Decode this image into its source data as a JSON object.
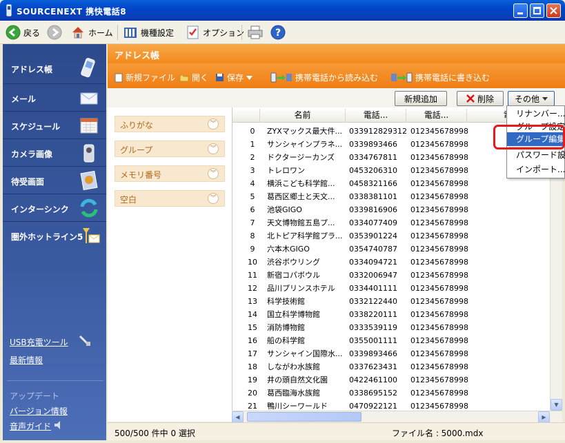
{
  "window": {
    "title": "SOURCENEXT 携快電話8"
  },
  "toolbar": {
    "back": "戻る",
    "home": "ホーム",
    "model": "機種設定",
    "options": "オプション"
  },
  "nav": {
    "items": [
      "アドレス帳",
      "メール",
      "スケジュール",
      "カメラ画像",
      "待受画面",
      "インターシンク",
      "圏外ホットライン5"
    ],
    "usb": "USB充電ツール",
    "news": "最新情報",
    "update": "アップデート",
    "version": "バージョン情報",
    "voice": "音声ガイド"
  },
  "content": {
    "header": "アドレス帳",
    "file": {
      "new": "新規ファイル",
      "open": "開く",
      "save": "保存",
      "read": "携帯電話から読み込む",
      "write": "携帯電話に書き込む"
    },
    "buttons": {
      "add": "新規追加",
      "delete": "削除",
      "other": "その他"
    }
  },
  "filters": [
    "ふりがな",
    "グループ",
    "メモリ番号",
    "空白"
  ],
  "table": {
    "columns": [
      "名前",
      "電話...",
      "電話...",
      "電..."
    ],
    "rows": [
      [
        "0",
        "ZYXマックス最大件...",
        "033912829312...",
        "012345678998..."
      ],
      [
        "1",
        "サンシャインプラネ...",
        "0339893466",
        "012345678998..."
      ],
      [
        "2",
        "ドクタージーカンズ",
        "0334767811",
        "012345678998..."
      ],
      [
        "3",
        "トレロワン",
        "0453206310",
        "012345678998..."
      ],
      [
        "4",
        "横浜こども科学館...",
        "0458321166",
        "012345678998..."
      ],
      [
        "5",
        "葛西区郷土と天文...",
        "0338381101",
        "012345678998..."
      ],
      [
        "6",
        "池袋GIGO",
        "0339816906",
        "012345678998..."
      ],
      [
        "7",
        "天文博物館五島プ...",
        "0334077409",
        "012345678998..."
      ],
      [
        "8",
        "北トピア科学館プラ...",
        "0353901224",
        "012345678998..."
      ],
      [
        "9",
        "六本木GIGO",
        "0354740787",
        "012345678998..."
      ],
      [
        "10",
        "渋谷ボウリング",
        "0334094721",
        "012345678998..."
      ],
      [
        "11",
        "新宿コパボウル",
        "0332006947",
        "012345678998..."
      ],
      [
        "12",
        "品川プリンスホテル",
        "0334401111",
        "012345678998..."
      ],
      [
        "13",
        "科学技術館",
        "0332122440",
        "012345678998..."
      ],
      [
        "14",
        "国立科学博物館",
        "0338220111",
        "012345678998..."
      ],
      [
        "15",
        "消防博物館",
        "0333539119",
        "012345678998..."
      ],
      [
        "16",
        "船の科学館",
        "0355001111",
        "012345678998..."
      ],
      [
        "17",
        "サンシャイン国際水...",
        "0339893466",
        "012345678998..."
      ],
      [
        "18",
        "しながわ水族館",
        "0337623431",
        "012345678998..."
      ],
      [
        "19",
        "井の頭自然文化園",
        "0422461100",
        "012345678998..."
      ],
      [
        "20",
        "葛西臨海水族館",
        "0338695152",
        "012345678998..."
      ],
      [
        "21",
        "鴨川シーワールド",
        "0470922121",
        "012345678998..."
      ]
    ]
  },
  "status": {
    "count": "500/500 件中 0 選択",
    "file": "ファイル名 : 5000.mdx"
  },
  "menu": {
    "items": [
      "リナンバー...",
      "グループ設定",
      "グループ編集",
      "パスワード設定",
      "インポート..."
    ],
    "selected_index": 2
  },
  "colors": {
    "accent": "#f38a1c",
    "nav": "#2d4a8c",
    "highlight": "#e51b1b",
    "selection": "#316ac5"
  }
}
